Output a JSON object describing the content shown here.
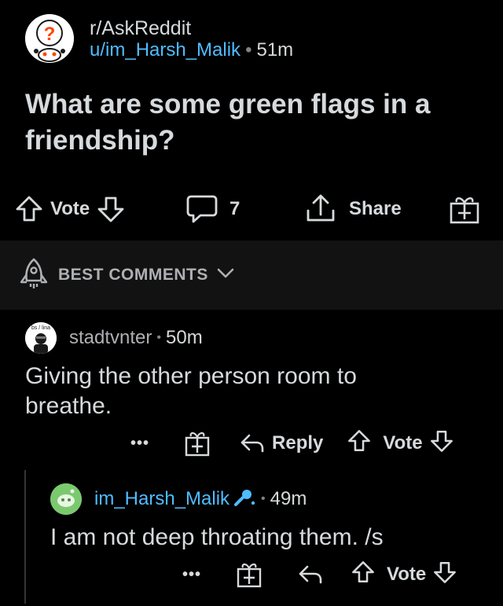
{
  "post": {
    "subreddit": "r/AskReddit",
    "author": "u/im_Harsh_Malik",
    "separator": "•",
    "age": "51m",
    "title": "What are some green flags in a friendship?",
    "vote_label": "Vote",
    "comment_count": "7",
    "share_label": "Share"
  },
  "sort": {
    "label": "BEST COMMENTS"
  },
  "comments": [
    {
      "author": "stadtvnter",
      "separator": "•",
      "age": "50m",
      "avatar_text": "bs / lina",
      "body": "Giving the other person room to breathe.",
      "more_label": "•••",
      "reply_label": "Reply",
      "vote_label": "Vote"
    },
    {
      "author": "im_Harsh_Malik",
      "separator": "•",
      "age": "49m",
      "body": "I am not deep throating them. /s",
      "more_label": "•••",
      "vote_label": "Vote"
    }
  ],
  "colors": {
    "background": "#000000",
    "link": "#4fbcff",
    "text": "#d7dadc",
    "sort_bar": "#121213"
  }
}
